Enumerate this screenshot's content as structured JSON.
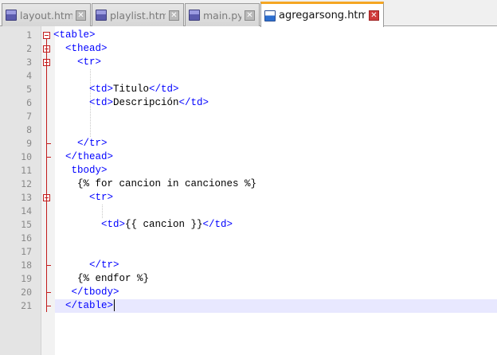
{
  "tabs": [
    {
      "label": "layout.html",
      "active": false
    },
    {
      "label": "playlist.html",
      "active": false
    },
    {
      "label": "main.py",
      "active": false
    },
    {
      "label": "agregarsong.html",
      "active": true
    }
  ],
  "close_glyph": "✕",
  "editor": {
    "current_line": 21,
    "lines": [
      {
        "n": "1",
        "indent": 0,
        "parts": [
          {
            "t": "<table>",
            "c": "tag"
          }
        ]
      },
      {
        "n": "2",
        "indent": 2,
        "parts": [
          {
            "t": "<thead>",
            "c": "tag"
          }
        ]
      },
      {
        "n": "3",
        "indent": 4,
        "parts": [
          {
            "t": "<tr>",
            "c": "tag"
          }
        ]
      },
      {
        "n": "4",
        "indent": 0,
        "parts": []
      },
      {
        "n": "5",
        "indent": 6,
        "parts": [
          {
            "t": "<td>",
            "c": "tag"
          },
          {
            "t": "Titulo",
            "c": "txt"
          },
          {
            "t": "</td>",
            "c": "tag"
          }
        ]
      },
      {
        "n": "6",
        "indent": 6,
        "parts": [
          {
            "t": "<td>",
            "c": "tag"
          },
          {
            "t": "Descripción",
            "c": "txt"
          },
          {
            "t": "</td>",
            "c": "tag"
          }
        ]
      },
      {
        "n": "7",
        "indent": 0,
        "parts": []
      },
      {
        "n": "8",
        "indent": 0,
        "parts": []
      },
      {
        "n": "9",
        "indent": 4,
        "parts": [
          {
            "t": "</tr>",
            "c": "tag"
          }
        ]
      },
      {
        "n": "10",
        "indent": 2,
        "parts": [
          {
            "t": "</thead>",
            "c": "tag"
          }
        ]
      },
      {
        "n": "11",
        "indent": 3,
        "parts": [
          {
            "t": "tbody>",
            "c": "tag"
          }
        ]
      },
      {
        "n": "12",
        "indent": 4,
        "parts": [
          {
            "t": "{% for cancion in canciones %}",
            "c": "tpl"
          }
        ]
      },
      {
        "n": "13",
        "indent": 6,
        "parts": [
          {
            "t": "<tr>",
            "c": "tag"
          }
        ]
      },
      {
        "n": "14",
        "indent": 0,
        "parts": []
      },
      {
        "n": "15",
        "indent": 8,
        "parts": [
          {
            "t": "<td>",
            "c": "tag"
          },
          {
            "t": "{{ cancion }}",
            "c": "tpl"
          },
          {
            "t": "</td>",
            "c": "tag"
          }
        ]
      },
      {
        "n": "16",
        "indent": 0,
        "parts": []
      },
      {
        "n": "17",
        "indent": 0,
        "parts": []
      },
      {
        "n": "18",
        "indent": 6,
        "parts": [
          {
            "t": "</tr>",
            "c": "tag"
          }
        ]
      },
      {
        "n": "19",
        "indent": 4,
        "parts": [
          {
            "t": "{% endfor %}",
            "c": "tpl"
          }
        ]
      },
      {
        "n": "20",
        "indent": 3,
        "parts": [
          {
            "t": "</tbody>",
            "c": "tag"
          }
        ]
      },
      {
        "n": "21",
        "indent": 2,
        "parts": [
          {
            "t": "</table>",
            "c": "tag"
          }
        ]
      }
    ]
  },
  "colors": {
    "tag": "#0000ff",
    "text": "#000000",
    "active_tab_accent": "#f5a623",
    "fold_marker": "#c21b1b",
    "current_line_bg": "#e8e8ff"
  }
}
